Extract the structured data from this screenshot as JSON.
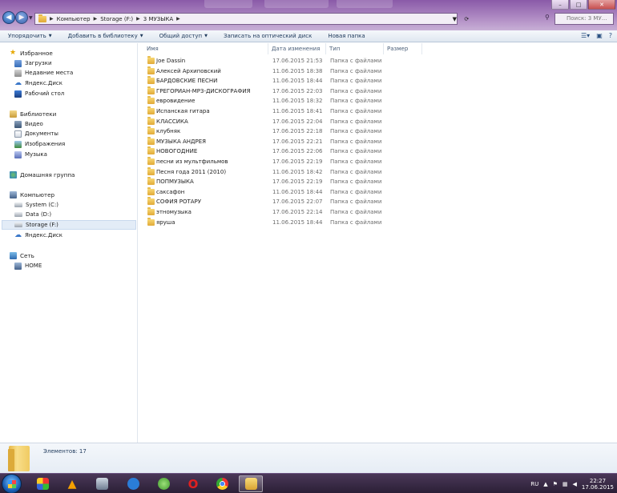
{
  "window": {
    "breadcrumbs": [
      "Компьютер",
      "Storage (F:)",
      "3 МУЗЫКА"
    ],
    "search_placeholder": "Поиск: 3 МУ...",
    "controls": {
      "minimize": "–",
      "maximize": "□",
      "close": "✕"
    }
  },
  "toolbar": {
    "items": [
      {
        "label": "Упорядочить",
        "dropdown": true
      },
      {
        "label": "Добавить в библиотеку",
        "dropdown": true
      },
      {
        "label": "Общий доступ",
        "dropdown": true
      },
      {
        "label": "Записать на оптический диск",
        "dropdown": false
      },
      {
        "label": "Новая папка",
        "dropdown": false
      }
    ],
    "view_icons": [
      "view-options-icon",
      "preview-pane-icon",
      "help-icon"
    ]
  },
  "sidebar": {
    "favorites": {
      "label": "Избранное",
      "items": [
        "Загрузки",
        "Недавние места",
        "Яндекс.Диск",
        "Рабочий стол"
      ]
    },
    "libraries": {
      "label": "Библиотеки",
      "items": [
        "Видео",
        "Документы",
        "Изображения",
        "Музыка"
      ]
    },
    "homegroup": {
      "label": "Домашняя группа"
    },
    "computer": {
      "label": "Компьютер",
      "items": [
        "System (C:)",
        "Data (D:)",
        "Storage (F:)",
        "Яндекс.Диск"
      ],
      "selected": "Storage (F:)"
    },
    "network": {
      "label": "Сеть",
      "items": [
        "HOME"
      ]
    }
  },
  "columns": {
    "name": "Имя",
    "date": "Дата изменения",
    "type": "Тип",
    "size": "Размер"
  },
  "files": [
    {
      "name": "Joe Dassin",
      "date": "17.06.2015 21:53",
      "type": "Папка с файлами"
    },
    {
      "name": "Алексей Архиповский",
      "date": "11.06.2015 18:38",
      "type": "Папка с файлами"
    },
    {
      "name": "БАРДОВСКИЕ ПЕСНИ",
      "date": "11.06.2015 18:44",
      "type": "Папка с файлами"
    },
    {
      "name": "ГРЕГОРИАН-МР3-ДИСКОГРАФИЯ",
      "date": "17.06.2015 22:03",
      "type": "Папка с файлами"
    },
    {
      "name": "евровидение",
      "date": "11.06.2015 18:32",
      "type": "Папка с файлами"
    },
    {
      "name": "Испанская гитара",
      "date": "11.06.2015 18:41",
      "type": "Папка с файлами"
    },
    {
      "name": "КЛАССИКА",
      "date": "17.06.2015 22:04",
      "type": "Папка с файлами"
    },
    {
      "name": "клубняк",
      "date": "17.06.2015 22:18",
      "type": "Папка с файлами"
    },
    {
      "name": "МУЗЫКА АНДРЕЯ",
      "date": "17.06.2015 22:21",
      "type": "Папка с файлами"
    },
    {
      "name": "НОВОГОДНИЕ",
      "date": "17.06.2015 22:06",
      "type": "Папка с файлами"
    },
    {
      "name": "песни из мультфильмов",
      "date": "17.06.2015 22:19",
      "type": "Папка с файлами"
    },
    {
      "name": "Песня года 2011 (2010)",
      "date": "11.06.2015 18:42",
      "type": "Папка с файлами"
    },
    {
      "name": "ПОПМУЗЫКА",
      "date": "17.06.2015 22:19",
      "type": "Папка с файлами"
    },
    {
      "name": "саксафон",
      "date": "11.06.2015 18:44",
      "type": "Папка с файлами"
    },
    {
      "name": "СОФИЯ РОТАРУ",
      "date": "17.06.2015 22:07",
      "type": "Папка с файлами"
    },
    {
      "name": "этномузыка",
      "date": "17.06.2015 22:14",
      "type": "Папка с файлами"
    },
    {
      "name": "яруша",
      "date": "11.06.2015 18:44",
      "type": "Папка с файлами"
    }
  ],
  "details": {
    "count": "Элементов: 17"
  },
  "taskbar": {
    "apps": [
      "switcher-icon",
      "aimp-icon",
      "calculator-icon",
      "cam-icon",
      "utorrent-icon",
      "opera-icon",
      "chrome-icon",
      "explorer-icon"
    ],
    "active": "explorer-icon",
    "lang": "RU",
    "time": "22:27",
    "date": "17.06.2015"
  }
}
